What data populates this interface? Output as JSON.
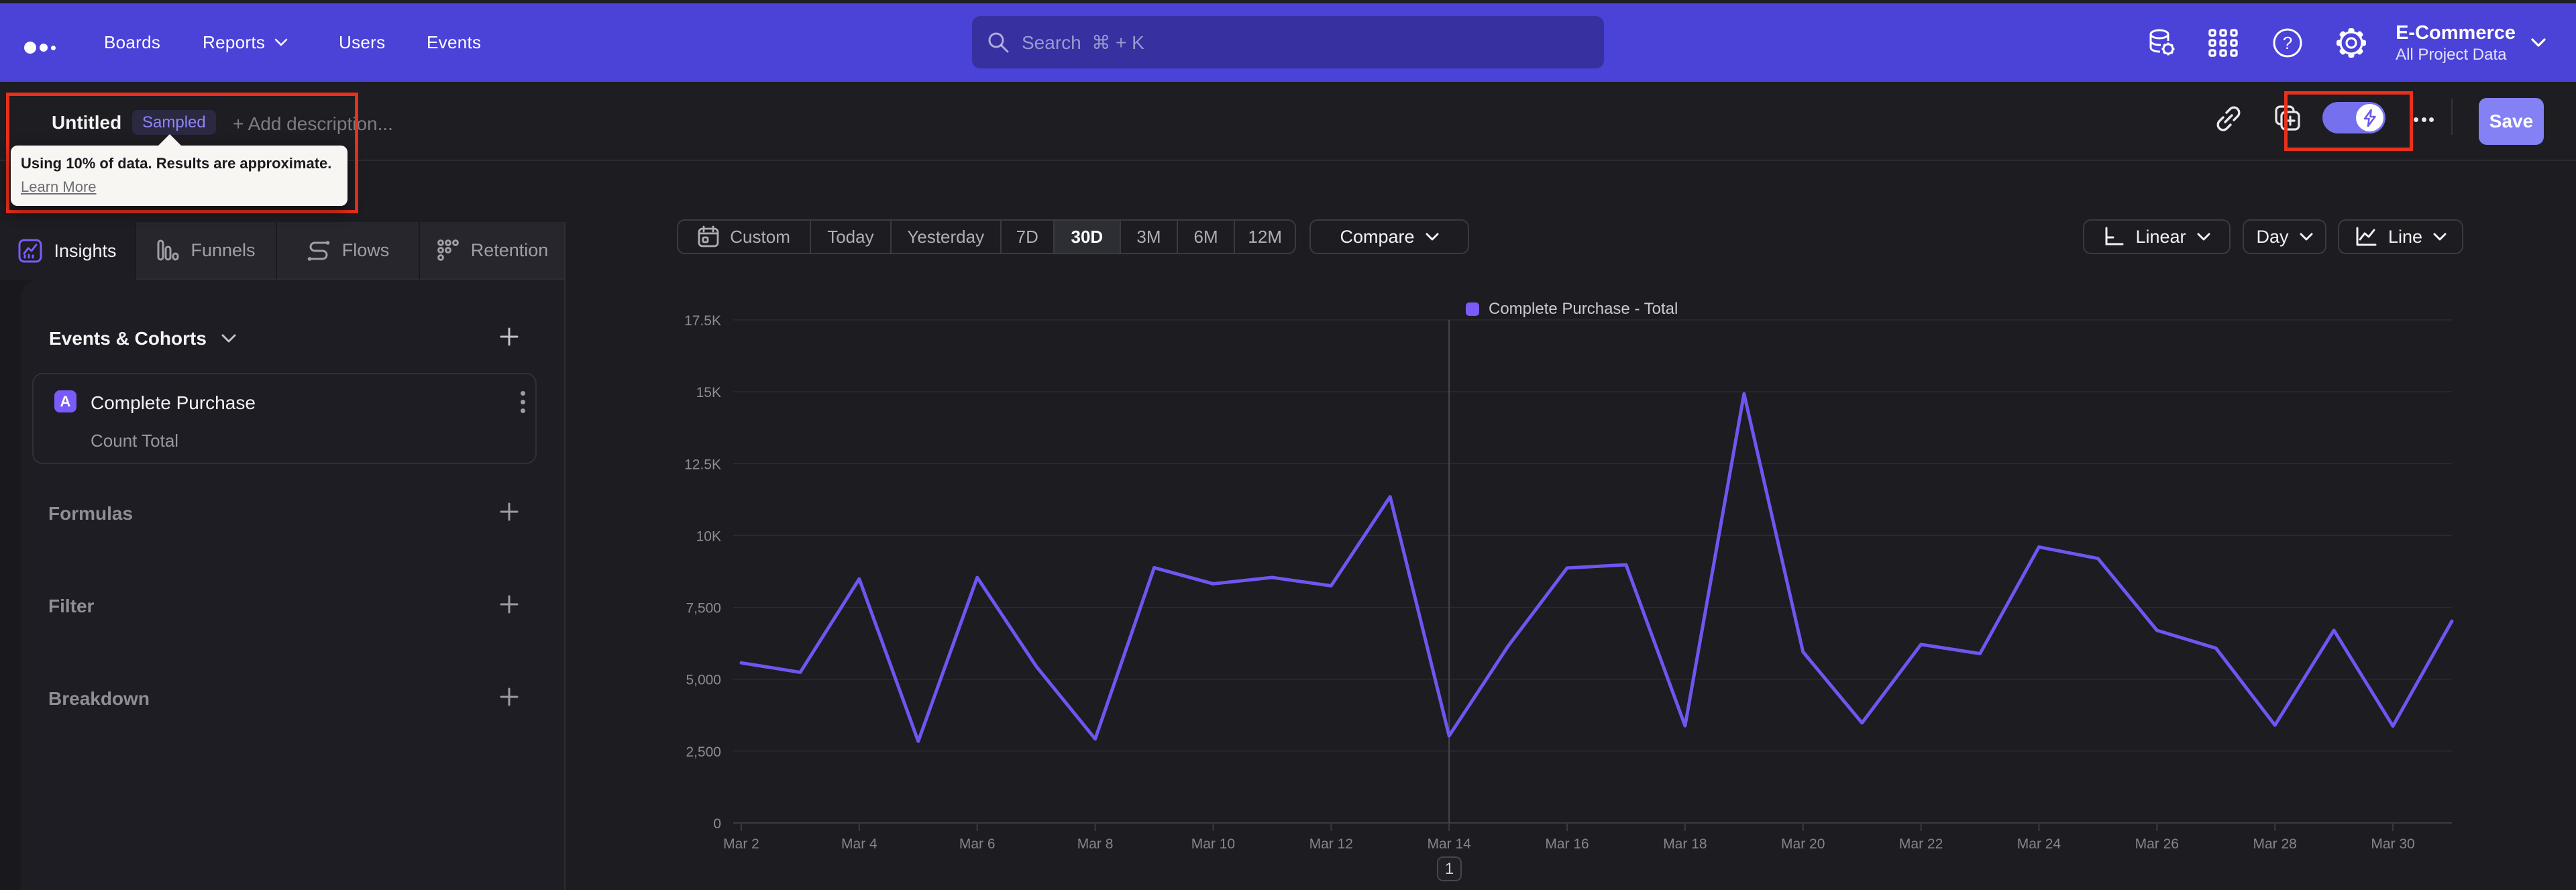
{
  "nav": {
    "items": [
      {
        "label": "Boards"
      },
      {
        "label": "Reports",
        "has_chevron": true
      },
      {
        "label": "Users"
      },
      {
        "label": "Events"
      }
    ],
    "search_placeholder": "Search  ⌘ + K",
    "icons": [
      "data-icon",
      "apps-grid-icon",
      "help-icon",
      "gear-icon"
    ],
    "project_name": "E-Commerce",
    "project_scope": "All Project Data"
  },
  "title_bar": {
    "title": "Untitled",
    "badge": "Sampled",
    "add_description": "+ Add description...",
    "save_label": "Save",
    "sampling_toggle_on": true
  },
  "tooltip": {
    "text": "Using 10% of data. Results are approximate.",
    "link": "Learn More"
  },
  "sidebar": {
    "tabs": [
      {
        "label": "Insights",
        "selected": true
      },
      {
        "label": "Funnels",
        "selected": false
      },
      {
        "label": "Flows",
        "selected": false
      },
      {
        "label": "Retention",
        "selected": false
      }
    ],
    "events_header": "Events & Cohorts",
    "event_card": {
      "badge": "A",
      "name": "Complete Purchase",
      "metric": "Count Total"
    },
    "sections": [
      "Formulas",
      "Filter",
      "Breakdown"
    ]
  },
  "controls": {
    "date_ranges": [
      "Custom",
      "Today",
      "Yesterday",
      "7D",
      "30D",
      "3M",
      "6M",
      "12M"
    ],
    "selected_range": "30D",
    "compare_label": "Compare",
    "scale_label": "Linear",
    "interval_label": "Day",
    "chart_type_label": "Line"
  },
  "chart_data": {
    "type": "line",
    "title": "",
    "legend": [
      {
        "name": "Complete Purchase - Total",
        "color": "#7B5BF7"
      }
    ],
    "x": [
      "Mar 2",
      "Mar 3",
      "Mar 4",
      "Mar 5",
      "Mar 6",
      "Mar 7",
      "Mar 8",
      "Mar 9",
      "Mar 10",
      "Mar 11",
      "Mar 12",
      "Mar 13",
      "Mar 14",
      "Mar 15",
      "Mar 16",
      "Mar 17",
      "Mar 18",
      "Mar 19",
      "Mar 20",
      "Mar 21",
      "Mar 22",
      "Mar 23",
      "Mar 24",
      "Mar 25",
      "Mar 26",
      "Mar 27",
      "Mar 28",
      "Mar 29",
      "Mar 30",
      "Mar 31"
    ],
    "series": [
      {
        "name": "Complete Purchase - Total",
        "values": [
          5570,
          5240,
          8490,
          2840,
          8540,
          5450,
          2920,
          8880,
          8320,
          8540,
          8250,
          11350,
          3030,
          6150,
          8870,
          8980,
          3380,
          14930,
          5950,
          3480,
          6210,
          5890,
          9600,
          9200,
          6700,
          6080,
          3400,
          6700,
          3370,
          7020
        ]
      }
    ],
    "x_tick_labels": [
      "Mar 2",
      "Mar 4",
      "Mar 6",
      "Mar 8",
      "Mar 10",
      "Mar 12",
      "Mar 14",
      "Mar 16",
      "Mar 18",
      "Mar 20",
      "Mar 22",
      "Mar 24",
      "Mar 26",
      "Mar 28",
      "Mar 30"
    ],
    "y_ticks": [
      {
        "value": 0,
        "label": "0"
      },
      {
        "value": 2500,
        "label": "2,500"
      },
      {
        "value": 5000,
        "label": "5,000"
      },
      {
        "value": 7500,
        "label": "7,500"
      },
      {
        "value": 10000,
        "label": "10K"
      },
      {
        "value": 12500,
        "label": "12.5K"
      },
      {
        "value": 15000,
        "label": "15K"
      },
      {
        "value": 17500,
        "label": "17.5K"
      }
    ],
    "ylim": [
      0,
      17500
    ],
    "line_color": "#6C57F0",
    "annotation_line_x": "Mar 14",
    "annotation_marker": "1",
    "grid": true,
    "legend_position": "top-center"
  },
  "annotations": {
    "marker_label": "1"
  }
}
